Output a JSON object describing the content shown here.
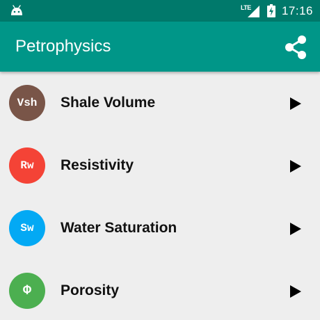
{
  "status_bar": {
    "network": "LTE",
    "time": "17:16",
    "left_icon": "android-icon",
    "battery_icon": "battery-charging-icon"
  },
  "app_bar": {
    "title": "Petrophysics",
    "action_icon": "share-icon",
    "color": "#009688",
    "status_color": "#00796b"
  },
  "items": [
    {
      "avatar_text": "Vsh",
      "label": "Shale Volume",
      "color": "#795548"
    },
    {
      "avatar_text": "Rw",
      "label": "Resistivity",
      "color": "#f44336"
    },
    {
      "avatar_text": "Sw",
      "label": "Water Saturation",
      "color": "#03a9f4"
    },
    {
      "avatar_text": "Φ",
      "label": "Porosity",
      "color": "#4caf50"
    }
  ]
}
